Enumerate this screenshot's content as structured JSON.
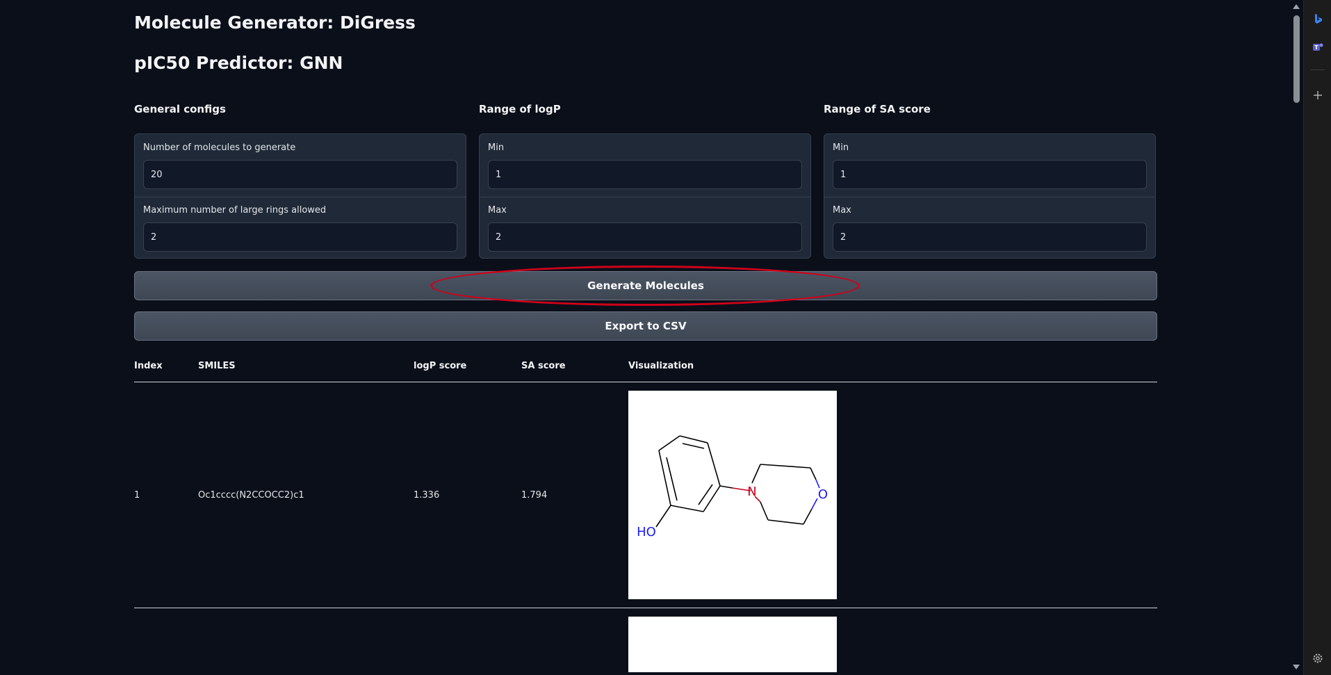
{
  "headings": {
    "molecule_generator": "Molecule Generator: DiGress",
    "predictor": "pIC50 Predictor: GNN"
  },
  "groups": {
    "general": {
      "label": "General configs",
      "field1_label": "Number of molecules to generate",
      "field1_value": "20",
      "field2_label": "Maximum number of large rings allowed",
      "field2_value": "2"
    },
    "logp": {
      "label": "Range of logP",
      "min_label": "Min",
      "min_value": "1",
      "max_label": "Max",
      "max_value": "2"
    },
    "sa": {
      "label": "Range of SA score",
      "min_label": "Min",
      "min_value": "1",
      "max_label": "Max",
      "max_value": "2"
    }
  },
  "buttons": {
    "generate": "Generate Molecules",
    "export": "Export to CSV"
  },
  "table": {
    "headers": [
      "Index",
      "SMILES",
      "logP score",
      "SA score",
      "Visualization"
    ],
    "rows": [
      {
        "index": "1",
        "smiles": "Oc1cccc(N2CCOCC2)c1",
        "logp": "1.336",
        "sa": "1.794",
        "atoms": {
          "n": "N",
          "o": "O",
          "ho": "HO"
        }
      }
    ]
  },
  "colors": {
    "background": "#0b0f19",
    "panel": "#1f2937",
    "button": "#4b5563",
    "annotation": "#d0021b",
    "nitrogen": "#c0001a",
    "oxygen": "#1a1aff"
  },
  "sidebar_icons": [
    "bing-icon",
    "teams-icon",
    "add-icon",
    "settings-icon"
  ]
}
